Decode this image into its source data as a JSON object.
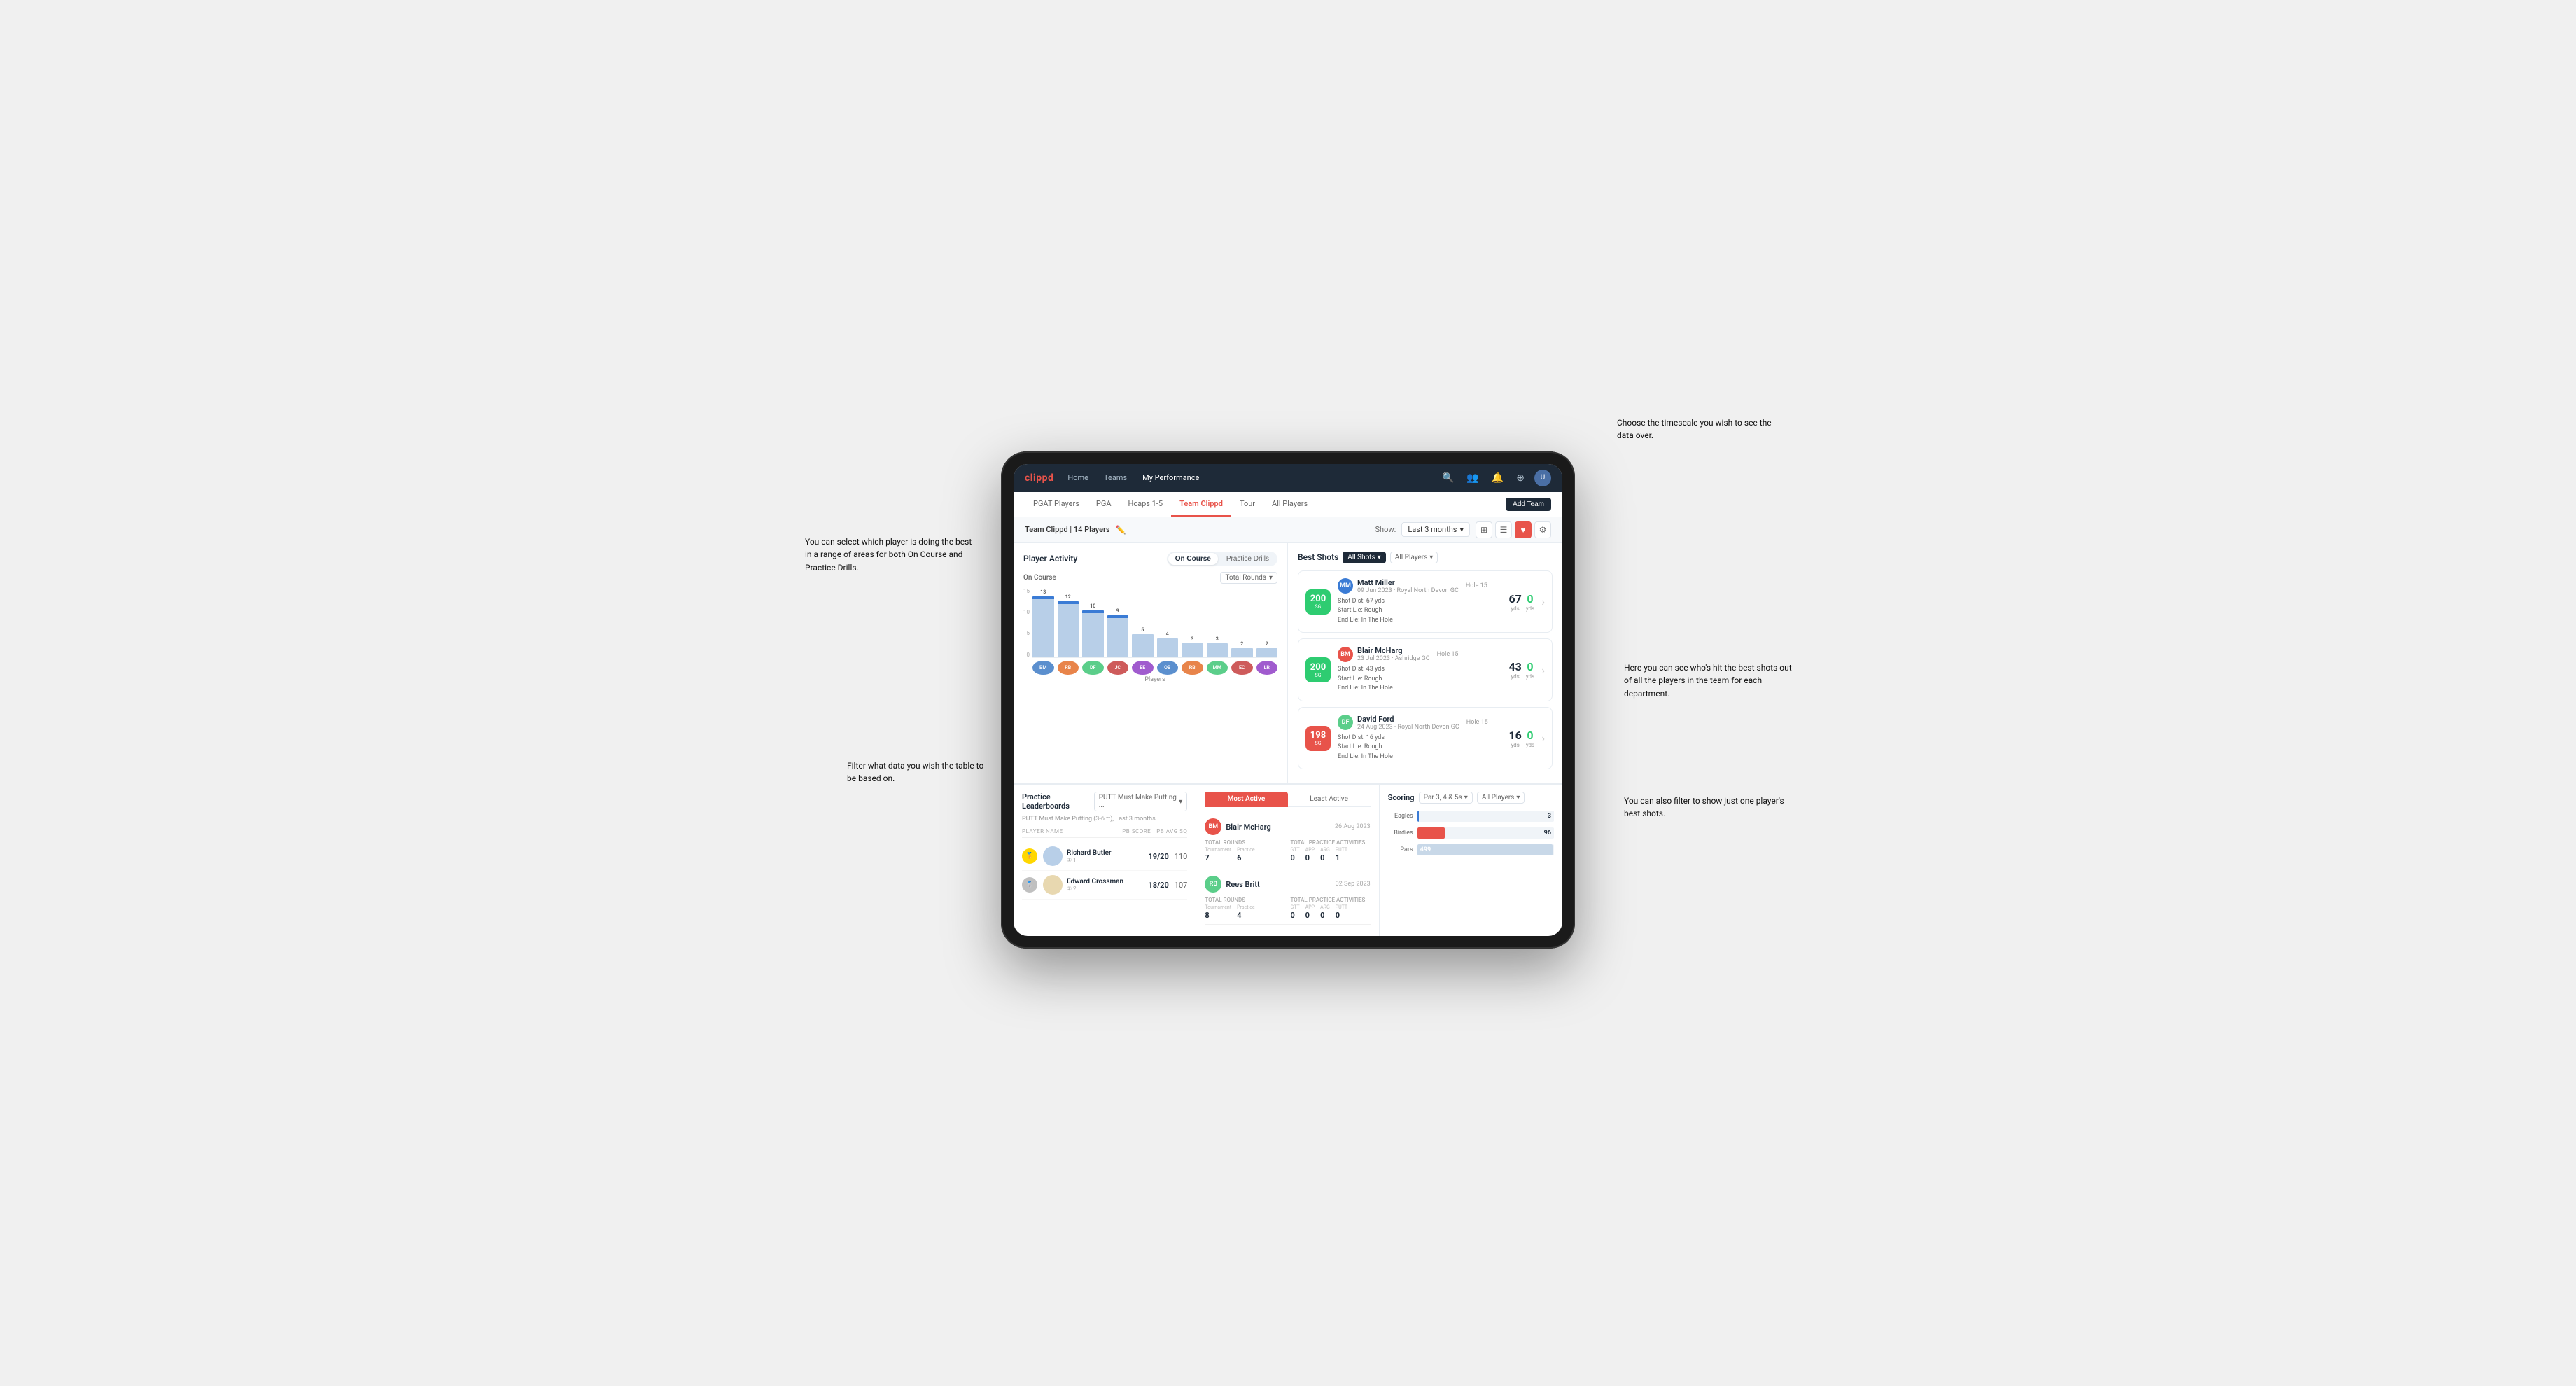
{
  "page": {
    "bg_color": "#f0f0f0"
  },
  "annotations": {
    "top_right": "Choose the timescale you\nwish to see the data over.",
    "right_mid": "Here you can see who's hit\nthe best shots out of all the\nplayers in the team for\neach department.",
    "right_bottom": "You can also filter to show\njust one player's best shots.",
    "top_left": "You can select which player is\ndoing the best in a range of\nareas for both On Course and\nPractice Drills.",
    "bottom_left": "Filter what data you wish the\ntable to be based on."
  },
  "top_nav": {
    "logo": "clippd",
    "links": [
      "Home",
      "Teams",
      "My Performance"
    ],
    "active_link": "My Performance"
  },
  "sub_nav": {
    "tabs": [
      "PGAT Players",
      "PGA",
      "Hcaps 1-5",
      "Team Clippd",
      "Tour",
      "All Players"
    ],
    "active_tab": "Team Clippd",
    "add_button": "Add Team"
  },
  "team_header": {
    "name": "Team Clippd | 14 Players",
    "show_label": "Show:",
    "show_value": "Last 3 months",
    "view_options": [
      "grid",
      "list",
      "heart",
      "settings"
    ]
  },
  "player_activity": {
    "title": "Player Activity",
    "toggle_options": [
      "On Course",
      "Practice Drills"
    ],
    "active_toggle": "On Course",
    "chart_title": "On Course",
    "chart_filter": "Total Rounds",
    "y_axis_labels": [
      "15",
      "10",
      "5",
      "0"
    ],
    "x_axis_label": "Players",
    "bars": [
      {
        "value": 13,
        "name": "B. McHarg",
        "height": 87
      },
      {
        "value": 12,
        "name": "R. Britt",
        "height": 80
      },
      {
        "value": 10,
        "name": "D. Ford",
        "height": 67
      },
      {
        "value": 9,
        "name": "J. Coles",
        "height": 60
      },
      {
        "value": 5,
        "name": "E. Ebert",
        "height": 33
      },
      {
        "value": 4,
        "name": "O. Billingham",
        "height": 27
      },
      {
        "value": 3,
        "name": "R. Butler",
        "height": 20
      },
      {
        "value": 3,
        "name": "M. Miller",
        "height": 20
      },
      {
        "value": 2,
        "name": "E. Crossman",
        "height": 13
      },
      {
        "value": 2,
        "name": "L. Robertson",
        "height": 13
      }
    ]
  },
  "best_shots": {
    "title": "Best Shots",
    "filter1": "All Shots",
    "filter2": "All Players",
    "players": [
      {
        "name": "Matt Miller",
        "date": "09 Jun 2023 · Royal North Devon GC",
        "hole": "Hole 15",
        "badge_value": "200",
        "badge_sub": "SG",
        "badge_color": "green",
        "shot_dist": "67 yds",
        "start_lie": "Rough",
        "end_lie": "In The Hole",
        "metric1": "67",
        "metric1_unit": "yds",
        "metric2": "0",
        "metric2_color": "green"
      },
      {
        "name": "Blair McHarg",
        "date": "23 Jul 2023 · Ashridge GC",
        "hole": "Hole 15",
        "badge_value": "200",
        "badge_sub": "SG",
        "badge_color": "green",
        "shot_dist": "43 yds",
        "start_lie": "Rough",
        "end_lie": "In The Hole",
        "metric1": "43",
        "metric1_unit": "yds",
        "metric2": "0",
        "metric2_color": "green"
      },
      {
        "name": "David Ford",
        "date": "24 Aug 2023 · Royal North Devon GC",
        "hole": "Hole 15",
        "badge_value": "198",
        "badge_sub": "SG",
        "badge_color": "red",
        "shot_dist": "16 yds",
        "start_lie": "Rough",
        "end_lie": "In The Hole",
        "metric1": "16",
        "metric1_unit": "yds",
        "metric2": "0",
        "metric2_color": "green"
      }
    ]
  },
  "practice_leaderboards": {
    "title": "Practice Leaderboards",
    "filter": "PUTT Must Make Putting ...",
    "subtitle": "PUTT Must Make Putting (3-6 ft), Last 3 months",
    "col_name": "PLAYER NAME",
    "col_pb": "PB SCORE",
    "col_avg": "PB AVG SQ",
    "players": [
      {
        "rank": "1",
        "rank_type": "gold",
        "name": "Richard Butler",
        "sub": "1",
        "score": "19/20",
        "avg": "110"
      },
      {
        "rank": "2",
        "rank_type": "silver",
        "name": "Edward Crossman",
        "sub": "2",
        "score": "18/20",
        "avg": "107"
      }
    ]
  },
  "most_active": {
    "tabs": [
      "Most Active",
      "Least Active"
    ],
    "active_tab": "Most Active",
    "players": [
      {
        "name": "Blair McHarg",
        "date": "26 Aug 2023",
        "total_rounds_label": "Total Rounds",
        "tournament_label": "Tournament",
        "practice_label": "Practice",
        "tournament_val": "7",
        "practice_val": "6",
        "total_practice_label": "Total Practice Activities",
        "gtt_label": "GTT",
        "app_label": "APP",
        "arg_label": "ARG",
        "putt_label": "PUTT",
        "gtt_val": "0",
        "app_val": "0",
        "arg_val": "0",
        "putt_val": "1"
      },
      {
        "name": "Rees Britt",
        "date": "02 Sep 2023",
        "tournament_val": "8",
        "practice_val": "4",
        "gtt_val": "0",
        "app_val": "0",
        "arg_val": "0",
        "putt_val": "0"
      }
    ]
  },
  "scoring": {
    "title": "Scoring",
    "filter1": "Par 3, 4 & 5s",
    "filter2": "All Players",
    "bars": [
      {
        "label": "Eagles",
        "value": 3,
        "max": 500,
        "color": "#3a7bd5"
      },
      {
        "label": "Birdies",
        "value": 96,
        "max": 500,
        "color": "#e8534a"
      },
      {
        "label": "Pars",
        "value": 499,
        "max": 500,
        "color": "#c8d8e8"
      }
    ]
  }
}
